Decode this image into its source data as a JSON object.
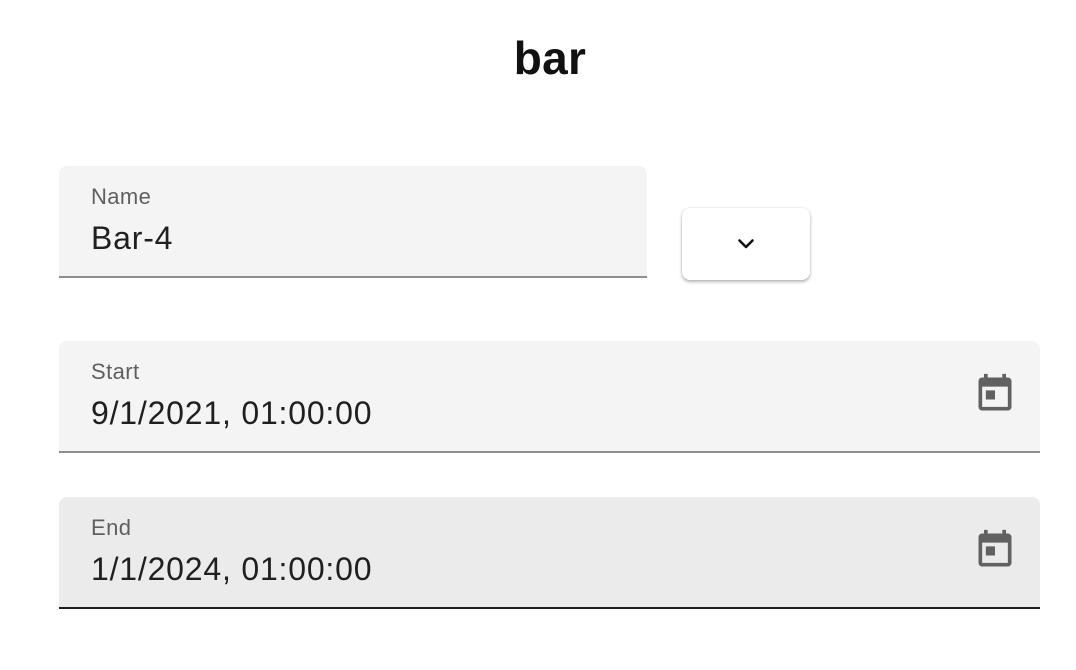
{
  "page": {
    "title": "bar"
  },
  "form": {
    "name": {
      "label": "Name",
      "value": "Bar-4"
    },
    "dropdown": {
      "icon": "chevron-down-icon"
    },
    "start": {
      "label": "Start",
      "value": "9/1/2021, 01:00:00",
      "icon": "calendar-icon"
    },
    "end": {
      "label": "End",
      "value": "1/1/2024, 01:00:00",
      "icon": "calendar-icon"
    }
  },
  "colors": {
    "field_background": "#f4f4f4",
    "field_background_focused": "#ebebeb",
    "icon_color": "#616161",
    "label_color": "#5f5f5f"
  }
}
